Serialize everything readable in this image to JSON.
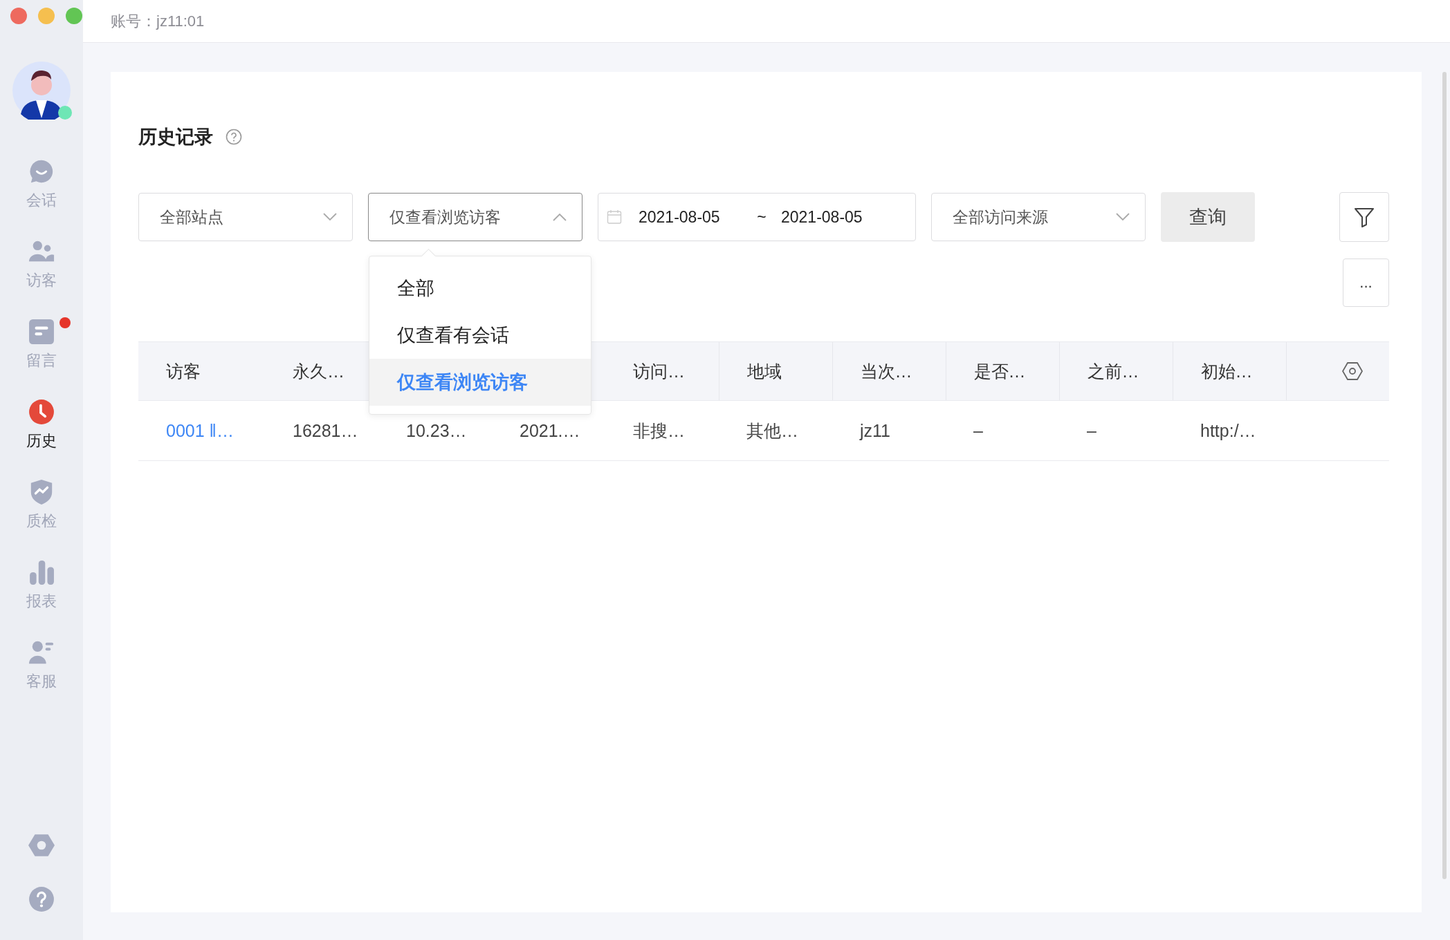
{
  "window": {
    "account": "账号：jz11:01"
  },
  "sidebar": {
    "avatar": {
      "online": true
    },
    "items": [
      {
        "kind": "chat",
        "label": "会话",
        "selected": false,
        "badge": false
      },
      {
        "kind": "visitors",
        "label": "访客",
        "selected": false,
        "badge": false
      },
      {
        "kind": "message",
        "label": "留言",
        "selected": false,
        "badge": true
      },
      {
        "kind": "history",
        "label": "历史",
        "selected": true,
        "badge": false
      },
      {
        "kind": "quality",
        "label": "质检",
        "selected": false,
        "badge": false
      },
      {
        "kind": "report",
        "label": "报表",
        "selected": false,
        "badge": false
      },
      {
        "kind": "agent",
        "label": "客服",
        "selected": false,
        "badge": false
      }
    ],
    "bottom": [
      {
        "kind": "settings"
      },
      {
        "kind": "help"
      }
    ]
  },
  "page": {
    "title": "历史记录",
    "filters": [
      {
        "kind": "select",
        "value": "全部站点",
        "open": false
      },
      {
        "kind": "select",
        "value": "仅查看浏览访客",
        "open": true,
        "options": [
          {
            "label": "全部",
            "selected": false
          },
          {
            "label": "仅查看有会话",
            "selected": false
          },
          {
            "label": "仅查看浏览访客",
            "selected": true
          }
        ]
      },
      {
        "kind": "date",
        "start": "2021-08-05",
        "separator": "~",
        "end": "2021-08-05"
      },
      {
        "kind": "select",
        "value": "全部访问来源",
        "open": false
      }
    ],
    "query_button": "查询",
    "more_button": "...",
    "table": {
      "columns": [
        {
          "label": "访客"
        },
        {
          "label": "永久…"
        },
        {},
        {},
        {
          "label": "访问…"
        },
        {
          "label": "地域"
        },
        {
          "label": "当次…"
        },
        {
          "label": "是否…"
        },
        {
          "label": "之前…"
        },
        {
          "label": "初始…"
        }
      ],
      "rows": [
        {
          "cells": [
            "0001 ‖…",
            "16281…",
            "10.23…",
            "2021.…",
            "非搜…",
            "其他…",
            "jz11",
            "–",
            "–",
            "http:/…"
          ]
        }
      ]
    }
  }
}
